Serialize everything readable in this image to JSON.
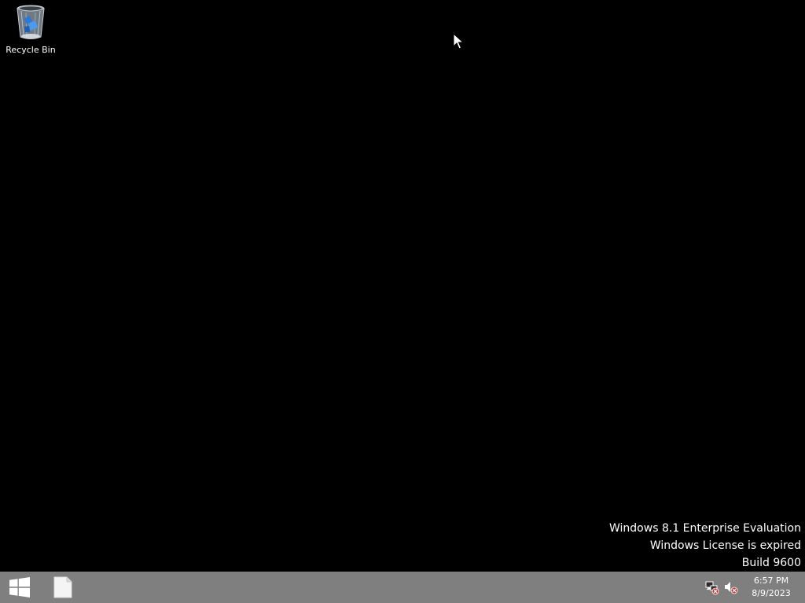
{
  "desktop": {
    "background_color": "#000000",
    "icons": [
      {
        "label": "Recycle Bin",
        "icon": "recycle-bin-icon"
      }
    ]
  },
  "watermark": {
    "line1": "Windows 8.1 Enterprise Evaluation",
    "line2": "Windows License is expired",
    "line3": "Build 9600"
  },
  "taskbar": {
    "background_color": "#7f7f7f",
    "start_icon": "windows-logo-icon",
    "pinned_apps": [
      {
        "icon": "blank-document-icon"
      }
    ],
    "tray": {
      "icons": [
        "network-disconnected-icon",
        "volume-muted-icon"
      ],
      "clock": {
        "time": "6:57 PM",
        "date": "8/9/2023"
      }
    }
  }
}
